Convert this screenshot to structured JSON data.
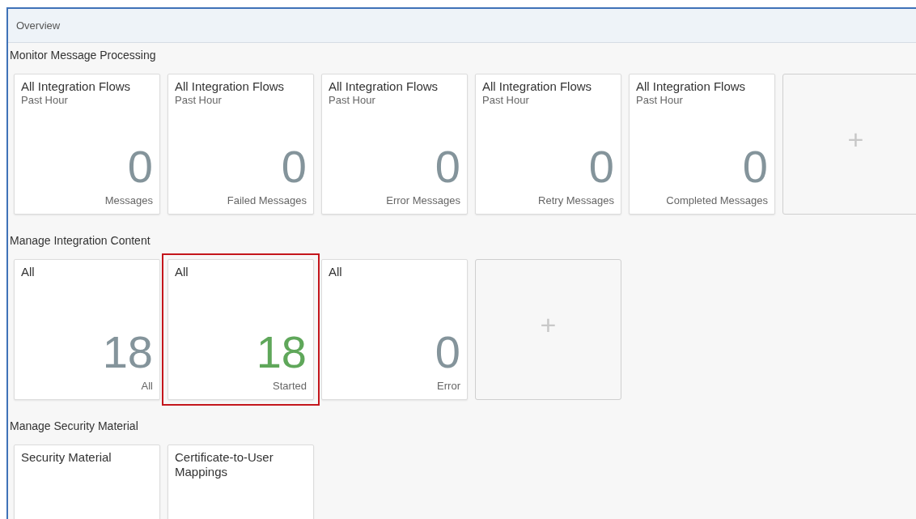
{
  "header": {
    "title": "Overview"
  },
  "sections": [
    {
      "title": "Monitor Message Processing",
      "tiles": [
        {
          "kind": "stat",
          "title": "All Integration Flows",
          "subtitle": "Past Hour",
          "value": "0",
          "positive": false,
          "footer": "Messages",
          "highlighted": false
        },
        {
          "kind": "stat",
          "title": "All Integration Flows",
          "subtitle": "Past Hour",
          "value": "0",
          "positive": false,
          "footer": "Failed Messages",
          "highlighted": false
        },
        {
          "kind": "stat",
          "title": "All Integration Flows",
          "subtitle": "Past Hour",
          "value": "0",
          "positive": false,
          "footer": "Error Messages",
          "highlighted": false
        },
        {
          "kind": "stat",
          "title": "All Integration Flows",
          "subtitle": "Past Hour",
          "value": "0",
          "positive": false,
          "footer": "Retry Messages",
          "highlighted": false
        },
        {
          "kind": "stat",
          "title": "All Integration Flows",
          "subtitle": "Past Hour",
          "value": "0",
          "positive": false,
          "footer": "Completed Messages",
          "highlighted": false
        },
        {
          "kind": "add",
          "text": "+"
        }
      ]
    },
    {
      "title": "Manage Integration Content",
      "tiles": [
        {
          "kind": "stat",
          "title": "All",
          "value": "18",
          "positive": false,
          "footer": "All",
          "highlighted": false
        },
        {
          "kind": "stat",
          "title": "All",
          "value": "18",
          "positive": true,
          "footer": "Started",
          "highlighted": true
        },
        {
          "kind": "stat",
          "title": "All",
          "value": "0",
          "positive": false,
          "footer": "Error",
          "highlighted": false
        },
        {
          "kind": "add",
          "text": "+"
        }
      ]
    },
    {
      "title": "Manage Security Material",
      "tiles": [
        {
          "kind": "stat",
          "title": "Security Material",
          "highlighted": false
        },
        {
          "kind": "stat",
          "title": "Certificate-to-User Mappings",
          "highlighted": false
        }
      ]
    }
  ]
}
